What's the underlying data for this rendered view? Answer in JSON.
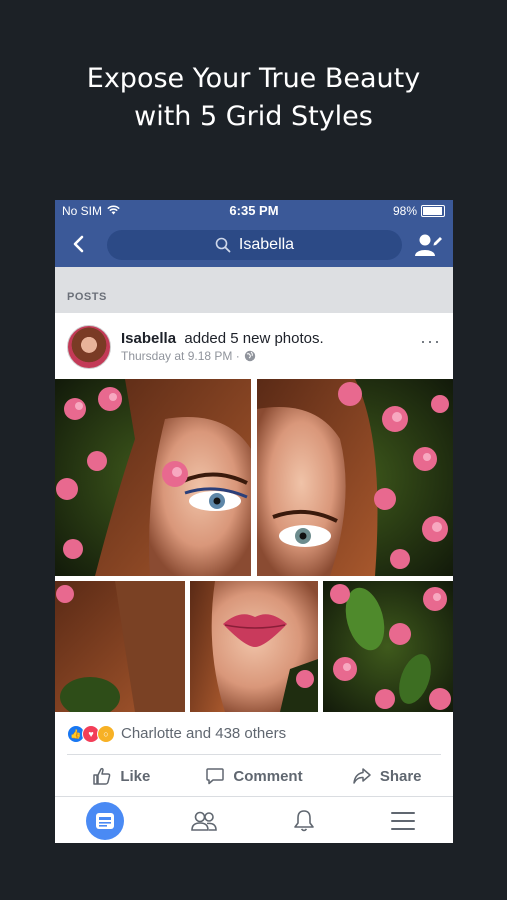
{
  "headline": {
    "line1": "Expose Your True Beauty",
    "line2": "with 5 Grid Styles"
  },
  "status_bar": {
    "carrier": "No SIM",
    "time": "6:35 PM",
    "battery": "98%"
  },
  "nav": {
    "search_text": "Isabella"
  },
  "section": {
    "label": "POSTS"
  },
  "post": {
    "author": "Isabella",
    "action": "added 5 new photos.",
    "timestamp": "Thursday at 9.18 PM ·",
    "more": "···"
  },
  "reactions": {
    "summary": "Charlotte and 438 others",
    "icons": [
      "like-icon",
      "love-icon",
      "wow-icon"
    ]
  },
  "actions": {
    "like": "Like",
    "comment": "Comment",
    "share": "Share"
  },
  "tabbar": {
    "tabs": [
      "news-feed-icon",
      "friends-icon",
      "notifications-icon",
      "menu-icon"
    ],
    "active": "news-feed-icon"
  },
  "colors": {
    "brand_blue": "#3b5998",
    "active_tab": "#4a8af4",
    "background": "#1c2126"
  }
}
